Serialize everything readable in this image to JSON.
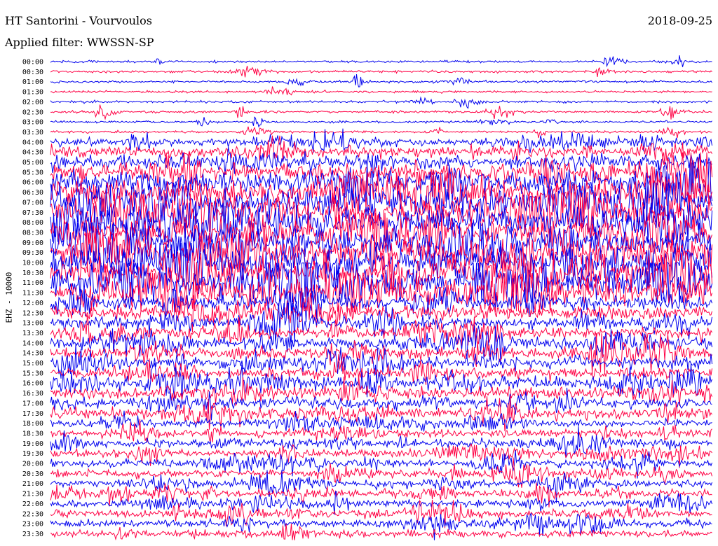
{
  "header": {
    "station": "HT Santorini - Vourvoulos",
    "filter": "Applied filter: WWSSN-SP",
    "date": "2018-09-25"
  },
  "colors": {
    "trace_a": "#0000ee",
    "trace_b": "#ff0044",
    "background": "#ffffff",
    "text": "#000000"
  },
  "chart_data": {
    "type": "line",
    "title": "HT Santorini - Vourvoulos",
    "subtitle": "Applied filter: WWSSN-SP",
    "ylabel": "EHZ - 10000",
    "rows": [
      "00:00",
      "00:30",
      "01:00",
      "01:30",
      "02:00",
      "02:30",
      "03:00",
      "03:30",
      "04:00",
      "04:30",
      "05:00",
      "05:30",
      "06:00",
      "06:30",
      "07:00",
      "07:30",
      "08:00",
      "08:30",
      "09:00",
      "09:30",
      "10:00",
      "10:30",
      "11:00",
      "11:30",
      "12:00",
      "12:30",
      "13:00",
      "13:30",
      "14:00",
      "14:30",
      "15:00",
      "15:30",
      "16:00",
      "16:30",
      "17:00",
      "17:30",
      "18:00",
      "18:30",
      "19:00",
      "19:30",
      "20:00",
      "20:30",
      "21:00",
      "21:30",
      "22:00",
      "22:30",
      "23:00",
      "23:30"
    ],
    "row_colors": [
      "trace_a",
      "trace_b"
    ],
    "grid": false,
    "legend": "none"
  }
}
